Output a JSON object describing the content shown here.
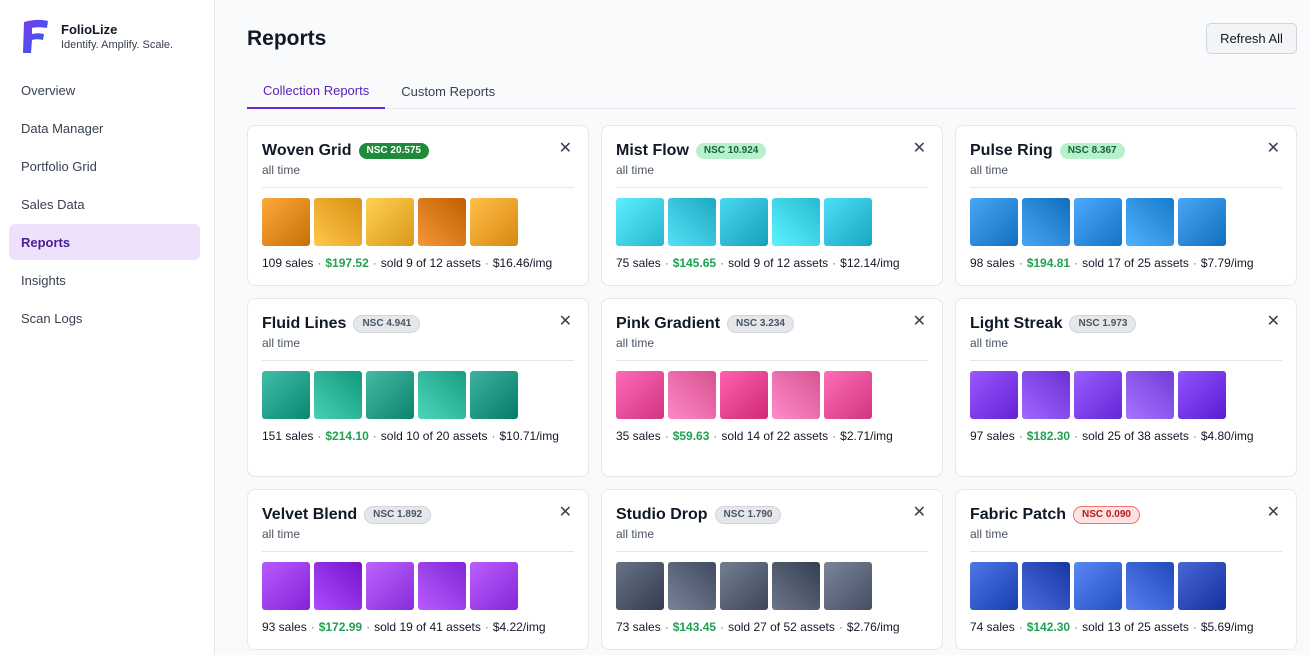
{
  "app": {
    "name": "FolioLize",
    "tagline": "Identify. Amplify. Scale."
  },
  "nav": [
    {
      "label": "Overview",
      "active": false
    },
    {
      "label": "Data Manager",
      "active": false
    },
    {
      "label": "Portfolio Grid",
      "active": false
    },
    {
      "label": "Sales Data",
      "active": false
    },
    {
      "label": "Reports",
      "active": true
    },
    {
      "label": "Insights",
      "active": false
    },
    {
      "label": "Scan Logs",
      "active": false
    }
  ],
  "page": {
    "title": "Reports",
    "refresh_label": "Refresh All"
  },
  "tabs": [
    {
      "label": "Collection Reports",
      "active": true
    },
    {
      "label": "Custom Reports",
      "active": false
    }
  ],
  "cards": [
    {
      "title": "Woven Grid",
      "badge": "NSC 20.575",
      "tier": "tier-1",
      "period": "all time",
      "colors": [
        "#e08a1e",
        "#f2a92c",
        "#f3b233",
        "#d9781a",
        "#f0a12a"
      ],
      "sales": "109 sales",
      "earnings": "$197.52",
      "sold": "sold 9 of 12 assets",
      "per_img": "$16.46/img"
    },
    {
      "title": "Mist Flow",
      "badge": "NSC 10.924",
      "tier": "tier-2",
      "period": "all time",
      "colors": [
        "#3fd0e6",
        "#36c3da",
        "#2eb9d3",
        "#3fd4ea",
        "#31c0d9"
      ],
      "sales": "75 sales",
      "earnings": "$145.65",
      "sold": "sold 9 of 12 assets",
      "per_img": "$12.14/img"
    },
    {
      "title": "Pulse Ring",
      "badge": "NSC 8.367",
      "tier": "tier-2",
      "period": "all time",
      "colors": [
        "#2b88d8",
        "#2a86d6",
        "#2d8be0",
        "#3094e4",
        "#2b87d7"
      ],
      "sales": "98 sales",
      "earnings": "$194.81",
      "sold": "sold 17 of 25 assets",
      "per_img": "$7.79/img"
    },
    {
      "title": "Fluid Lines",
      "badge": "NSC 4.941",
      "tier": "tier-3",
      "period": "all time",
      "colors": [
        "#23a08a",
        "#2bb196",
        "#249c86",
        "#30b89c",
        "#1f9481"
      ],
      "sales": "151 sales",
      "earnings": "$214.10",
      "sold": "sold 10 of 20 assets",
      "per_img": "$10.71/img"
    },
    {
      "title": "Pink Gradient",
      "badge": "NSC 3.234",
      "tier": "tier-3",
      "period": "all time",
      "colors": [
        "#ea4c9a",
        "#f06aa9",
        "#e8438f",
        "#f06dab",
        "#ea4f98"
      ],
      "sales": "35 sales",
      "earnings": "$59.63",
      "sold": "sold 14 of 22 assets",
      "per_img": "$2.71/img"
    },
    {
      "title": "Light Streak",
      "badge": "NSC 1.973",
      "tier": "tier-3",
      "period": "all time",
      "colors": [
        "#7c3aed",
        "#8349f0",
        "#7d3fef",
        "#8a55f2",
        "#7335ea"
      ],
      "sales": "97 sales",
      "earnings": "$182.30",
      "sold": "sold 25 of 38 assets",
      "per_img": "$4.80/img"
    },
    {
      "title": "Velvet Blend",
      "badge": "NSC 1.892",
      "tier": "tier-3",
      "period": "all time",
      "colors": [
        "#9b3cf0",
        "#8f2de6",
        "#a045f2",
        "#9a3ef0",
        "#9d40f1"
      ],
      "sales": "93 sales",
      "earnings": "$172.99",
      "sold": "sold 19 of 41 assets",
      "per_img": "$4.22/img"
    },
    {
      "title": "Studio Drop",
      "badge": "NSC 1.790",
      "tier": "tier-3",
      "period": "all time",
      "colors": [
        "#4b5568",
        "#5a6479",
        "#566073",
        "#4e586b",
        "#5d677b"
      ],
      "sales": "73 sales",
      "earnings": "$143.45",
      "sold": "sold 27 of 52 assets",
      "per_img": "$2.76/img"
    },
    {
      "title": "Fabric Patch",
      "badge": "NSC 0.090",
      "tier": "tier-4",
      "period": "all time",
      "colors": [
        "#3158c8",
        "#2f4fbe",
        "#3d69d8",
        "#3a62d3",
        "#2c49b8"
      ],
      "sales": "74 sales",
      "earnings": "$142.30",
      "sold": "sold 13 of 25 assets",
      "per_img": "$5.69/img"
    }
  ]
}
